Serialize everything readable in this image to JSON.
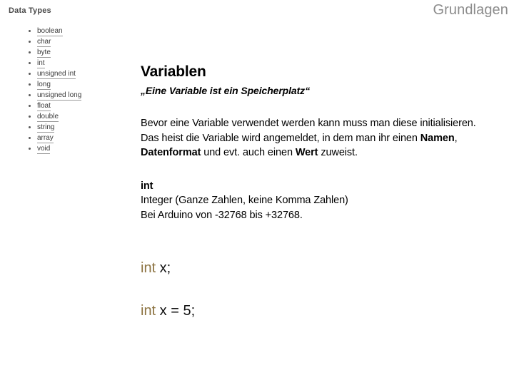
{
  "header": {
    "section_title": "Grundlagen"
  },
  "datatypes_panel": {
    "title": "Data Types",
    "items": [
      {
        "label": "boolean"
      },
      {
        "label": "char"
      },
      {
        "label": "byte"
      },
      {
        "label": "int"
      },
      {
        "label": "unsigned int"
      },
      {
        "label": "long"
      },
      {
        "label": "unsigned long"
      },
      {
        "label": "float"
      },
      {
        "label": "double"
      },
      {
        "label": "string"
      },
      {
        "label": "array"
      },
      {
        "label": "void"
      }
    ]
  },
  "content": {
    "heading": "Variablen",
    "subtitle": "„Eine Variable ist ein Speicherplatz“",
    "paragraph": {
      "part_1": "Bevor eine Variable verwendet werden kann muss man diese initialisieren. Das heist die Variable wird angemeldet, in dem man ihr einen ",
      "bold_1": "Namen",
      "part_2": ", ",
      "bold_2": "Datenformat",
      "part_3": " und evt. auch einen ",
      "bold_3": "Wert",
      "part_4": " zuweist."
    },
    "type_block": {
      "type_name": "int",
      "description_line_1": "Integer (Ganze Zahlen, keine Komma Zahlen)",
      "description_line_2": "Bei Arduino von -32768 bis +32768."
    }
  },
  "code_examples": [
    {
      "keyword": "int",
      "rest": " x;"
    },
    {
      "keyword": "int",
      "rest": " x = 5;"
    }
  ],
  "colors": {
    "keyword": "#8c7341",
    "section_title": "#8c8c8c",
    "panel_title": "#4a4a4a",
    "panel_text": "#3a3a3a",
    "body_text": "#000000"
  }
}
